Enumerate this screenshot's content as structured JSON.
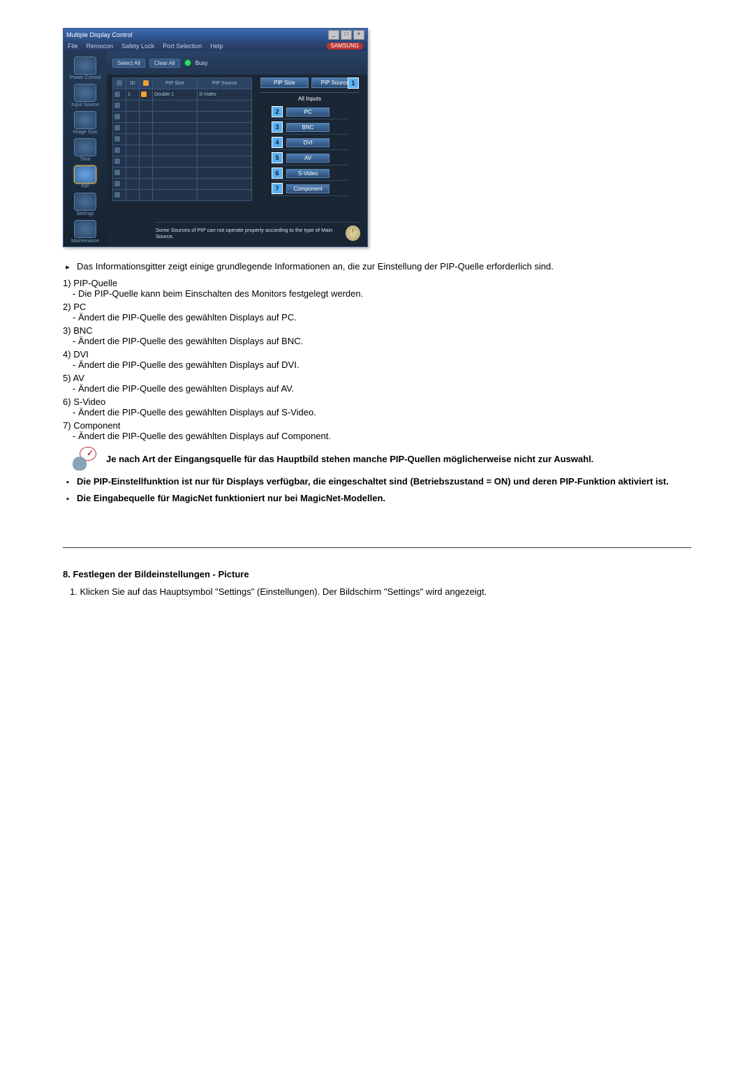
{
  "app": {
    "title": "Multiple Display Control",
    "menu": [
      "File",
      "Remocon",
      "Safety Lock",
      "Port Selection",
      "Help"
    ],
    "brand": "SAMSUNG"
  },
  "sidebar": {
    "items": [
      {
        "label": "Power Control"
      },
      {
        "label": "Input Source"
      },
      {
        "label": "Image Size"
      },
      {
        "label": "Time"
      },
      {
        "label": "PIP"
      },
      {
        "label": "Settings"
      },
      {
        "label": "Maintenance"
      }
    ],
    "active_index": 4
  },
  "toolbar": {
    "select_all": "Select All",
    "clear_all": "Clear All",
    "busy": "Busy"
  },
  "grid": {
    "headers": [
      "",
      "ID",
      "",
      "PIP Size",
      "PIP Source"
    ],
    "rows": [
      {
        "id": "1",
        "size": "Double 1",
        "source": "S-Video",
        "on_a": true,
        "on_b": true
      },
      {
        "id": "",
        "size": "",
        "source": ""
      },
      {
        "id": "",
        "size": "",
        "source": ""
      },
      {
        "id": "",
        "size": "",
        "source": ""
      },
      {
        "id": "",
        "size": "",
        "source": ""
      },
      {
        "id": "",
        "size": "",
        "source": ""
      },
      {
        "id": "",
        "size": "",
        "source": ""
      },
      {
        "id": "",
        "size": "",
        "source": ""
      },
      {
        "id": "",
        "size": "",
        "source": ""
      },
      {
        "id": "",
        "size": "",
        "source": ""
      }
    ]
  },
  "right_panel": {
    "tabs": [
      {
        "label": "PIP Size"
      },
      {
        "label": "PIP Source",
        "badge": "1"
      }
    ],
    "header": "All Inputs",
    "inputs": [
      {
        "num": "2",
        "label": "PC"
      },
      {
        "num": "3",
        "label": "BNC"
      },
      {
        "num": "4",
        "label": "DVI"
      },
      {
        "num": "5",
        "label": "AV"
      },
      {
        "num": "6",
        "label": "S-Video"
      },
      {
        "num": "7",
        "label": "Component"
      }
    ]
  },
  "footer_note": "Some Sources of PIP can not operate properly according to the type of Main Source.",
  "doc": {
    "intro": "Das Informationsgitter zeigt einige grundlegende Informationen an, die zur Einstellung der PIP-Quelle erforderlich sind.",
    "items": [
      {
        "num": "1)",
        "title": "PIP-Quelle",
        "desc": "- Die PIP-Quelle kann beim Einschalten des Monitors festgelegt werden."
      },
      {
        "num": "2)",
        "title": "PC",
        "desc": "- Ändert die PIP-Quelle des gewählten Displays auf PC."
      },
      {
        "num": "3)",
        "title": "BNC",
        "desc": "- Ändert die PIP-Quelle des gewählten Displays auf BNC."
      },
      {
        "num": "4)",
        "title": "DVI",
        "desc": "- Ändert die PIP-Quelle des gewählten Displays auf DVI."
      },
      {
        "num": "5)",
        "title": "AV",
        "desc": "- Ändert die PIP-Quelle des gewählten Displays auf AV."
      },
      {
        "num": "6)",
        "title": "S-Video",
        "desc": "- Ändert die PIP-Quelle des gewählten Displays auf S-Video."
      },
      {
        "num": "7)",
        "title": "Component",
        "desc": "- Ändert die PIP-Quelle des gewählten Displays auf Component."
      }
    ],
    "tip": "Je nach Art der Eingangsquelle für das Hauptbild stehen manche PIP-Quellen möglicherweise nicht zur Auswahl.",
    "bold1": "Die PIP-Einstellfunktion ist nur für Displays verfügbar, die eingeschaltet sind (Betriebszustand = ON) und deren PIP-Funktion aktiviert ist.",
    "bold2": "Die Eingabequelle für MagicNet funktioniert nur bei MagicNet-Modellen.",
    "section8_heading": "8. Festlegen der Bildeinstellungen - Picture",
    "section8_step": "1.  Klicken Sie auf das Hauptsymbol \"Settings\" (Einstellungen). Der Bildschirm \"Settings\" wird angezeigt."
  }
}
